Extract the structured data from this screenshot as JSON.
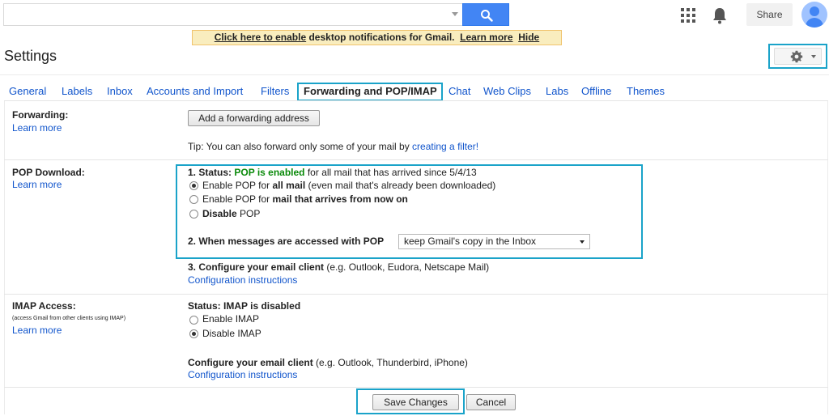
{
  "topbar": {
    "search_value": "",
    "share_label": "Share",
    "icons": [
      "search-icon",
      "apps-icon",
      "bell-icon",
      "avatar-icon"
    ]
  },
  "notification": {
    "enable_link": "Click here to enable",
    "text": " desktop notifications for Gmail.",
    "learn_more": "Learn more",
    "hide": "Hide"
  },
  "header": {
    "title": "Settings"
  },
  "tabs": [
    {
      "label": "General"
    },
    {
      "label": "Labels"
    },
    {
      "label": "Inbox"
    },
    {
      "label": "Accounts and Import"
    },
    {
      "label": "Filters"
    },
    {
      "label": "Forwarding and POP/IMAP"
    },
    {
      "label": "Chat"
    },
    {
      "label": "Web Clips"
    },
    {
      "label": "Labs"
    },
    {
      "label": "Offline"
    },
    {
      "label": "Themes"
    }
  ],
  "forwarding": {
    "label": "Forwarding:",
    "learn_more": "Learn more",
    "add_button": "Add a forwarding address",
    "tip_text": "Tip: You can also forward only some of your mail by ",
    "tip_link": "creating a filter!"
  },
  "pop": {
    "label": "POP Download:",
    "learn_more": "Learn more",
    "status_prefix": "1. Status: ",
    "status_value": "POP is enabled",
    "status_suffix": " for all mail that has arrived since 5/4/13",
    "options": [
      {
        "pre": "Enable POP for ",
        "bold": "all mail",
        "post": " (even mail that's already been downloaded)",
        "selected": true
      },
      {
        "pre": "Enable POP for ",
        "bold": "mail that arrives from now on",
        "post": "",
        "selected": false
      },
      {
        "pre": "",
        "bold": "Disable",
        "post": " POP",
        "selected": false
      }
    ],
    "access_label": "2. When messages are accessed with POP",
    "access_value": "keep Gmail's copy in the Inbox",
    "configure_bold": "3. Configure your email client",
    "configure_rest": " (e.g. Outlook, Eudora, Netscape Mail)",
    "config_link": "Configuration instructions"
  },
  "imap": {
    "label": "IMAP Access:",
    "subtext": "(access Gmail from other clients using IMAP)",
    "learn_more": "Learn more",
    "status": "Status: IMAP is disabled",
    "options": [
      {
        "label": "Enable IMAP",
        "selected": false
      },
      {
        "label": "Disable IMAP",
        "selected": true
      }
    ],
    "configure_bold": "Configure your email client",
    "configure_rest": " (e.g. Outlook, Thunderbird, iPhone)",
    "config_link": "Configuration instructions"
  },
  "footer": {
    "save_label": "Save Changes",
    "cancel_label": "Cancel"
  },
  "colors": {
    "accent_highlight": "#1aa3c9",
    "link": "#1155cc",
    "status_green": "#0a8a0a",
    "search_blue": "#4285f4",
    "banner": "#f9edbe"
  }
}
